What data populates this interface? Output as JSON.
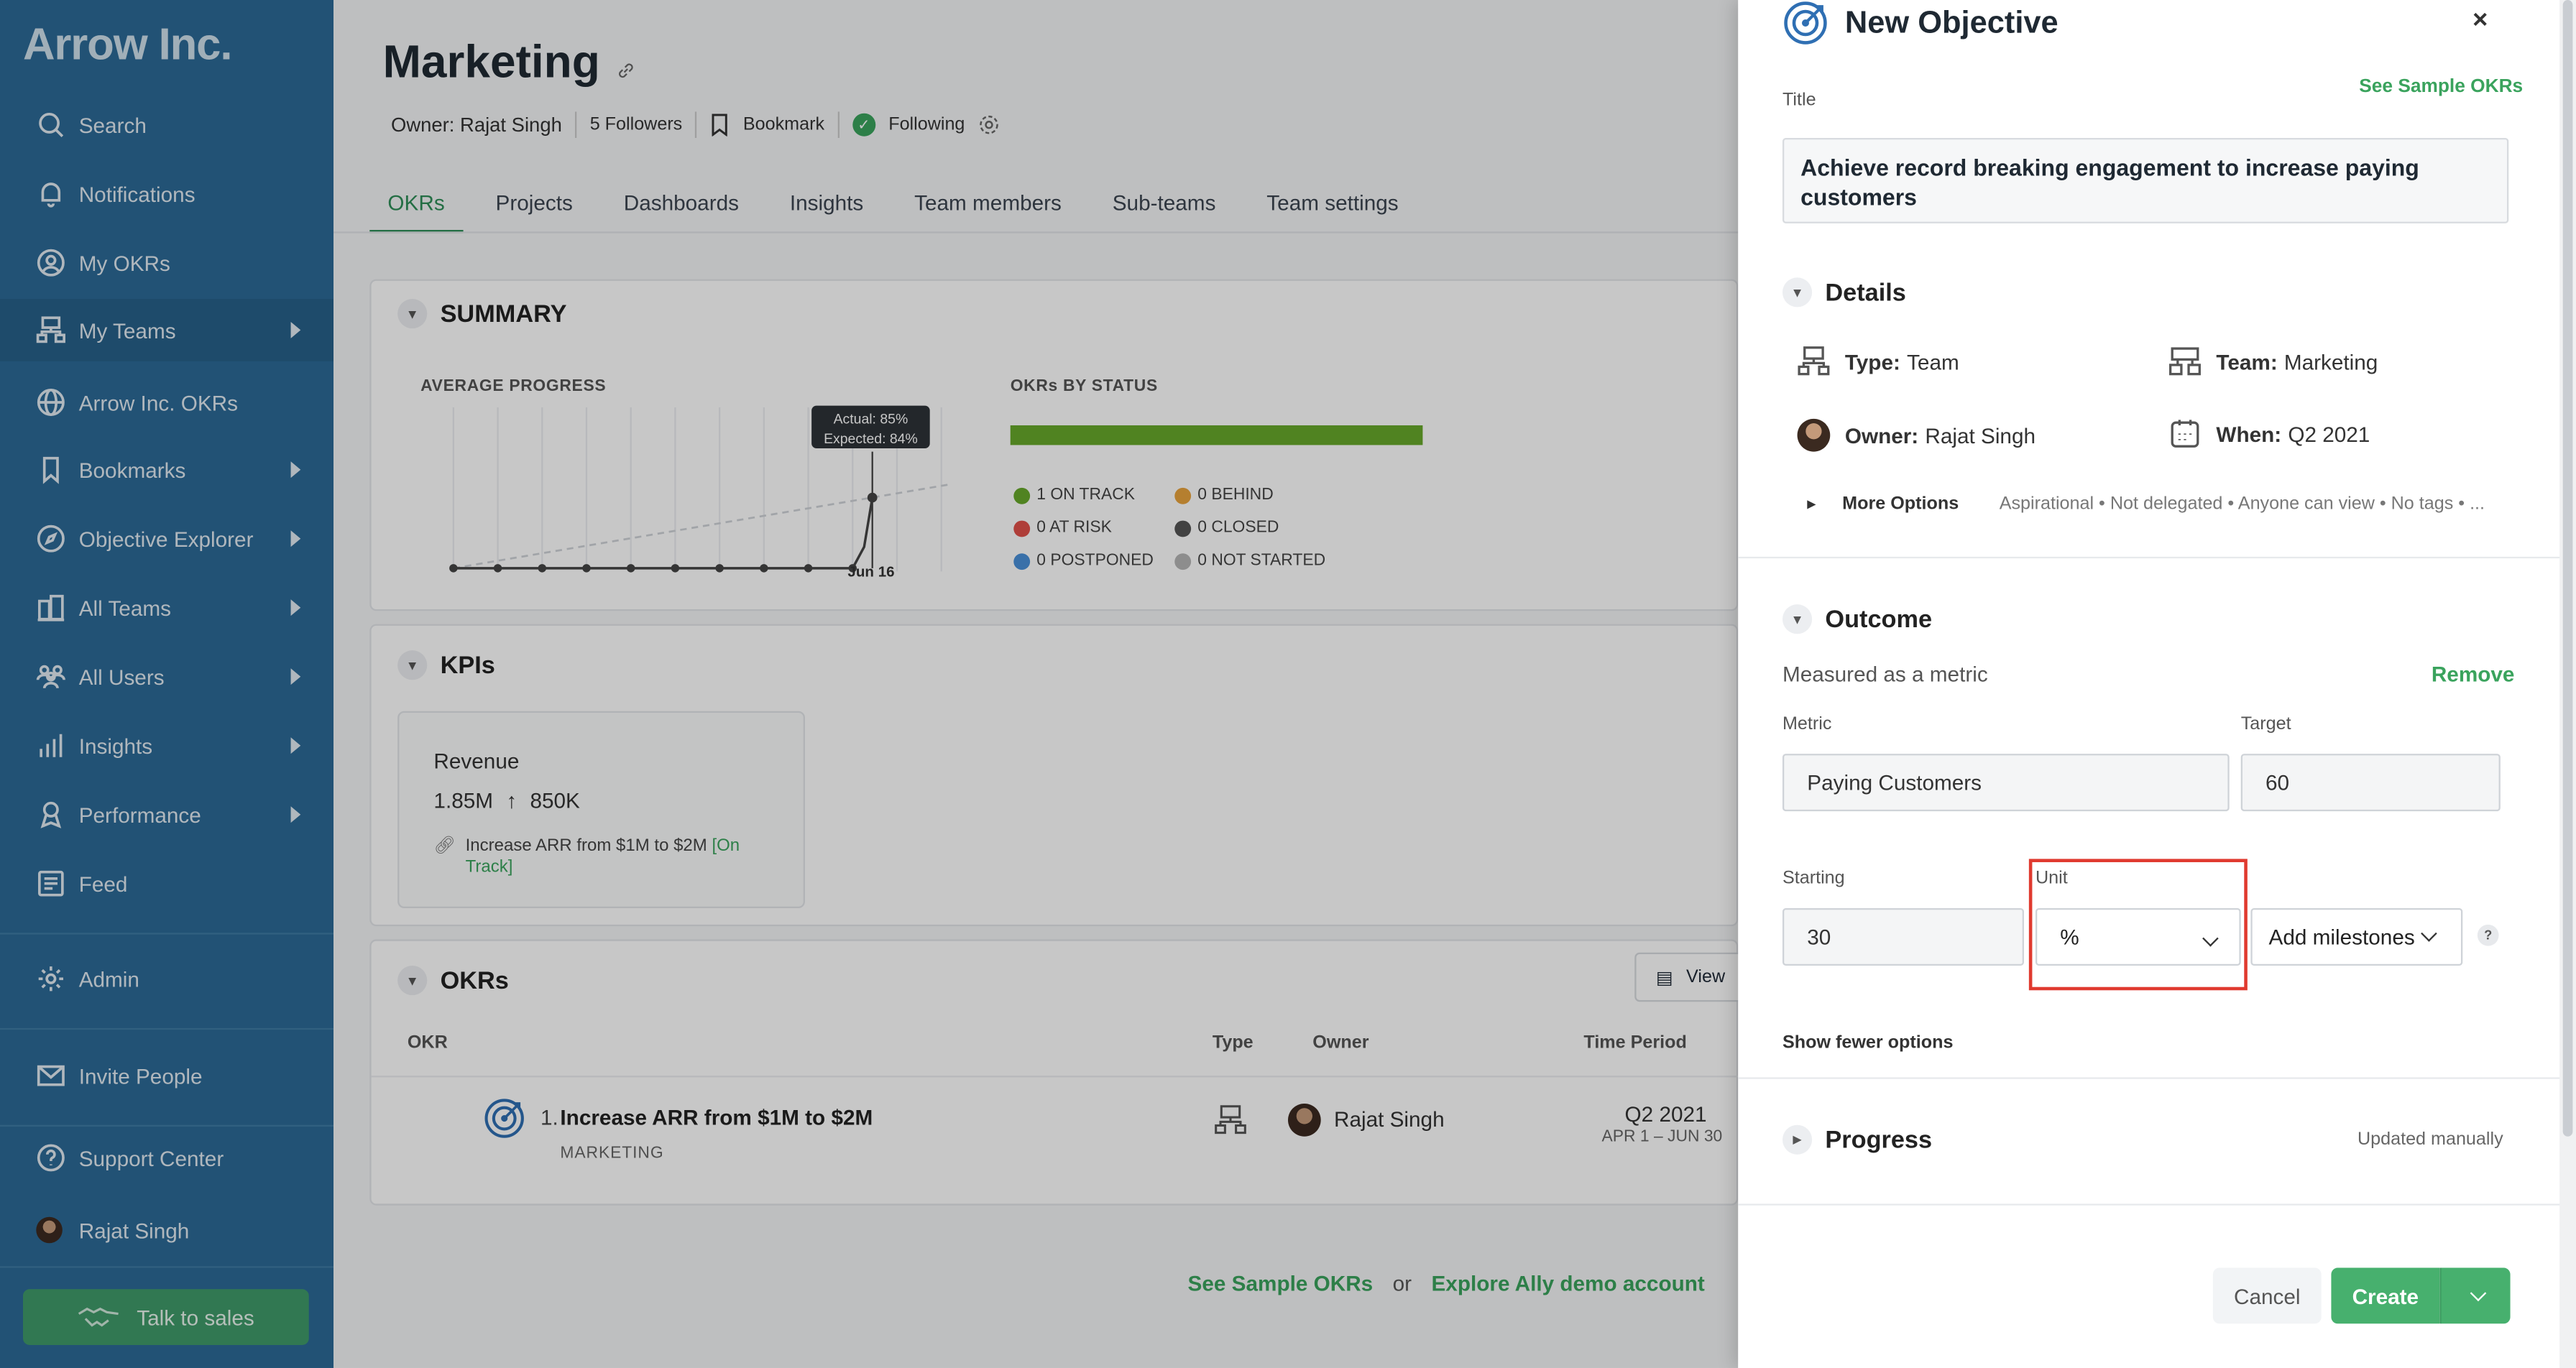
{
  "sidebar": {
    "brand": "Arrow Inc.",
    "items": [
      {
        "label": "Search",
        "icon": "search-icon"
      },
      {
        "label": "Notifications",
        "icon": "bell-icon"
      },
      {
        "label": "My OKRs",
        "icon": "user-circle-icon"
      },
      {
        "label": "My Teams",
        "icon": "team-hierarchy-icon"
      },
      {
        "label": "Arrow Inc. OKRs",
        "icon": "globe-icon"
      },
      {
        "label": "Bookmarks",
        "icon": "bookmark-icon"
      },
      {
        "label": "Objective Explorer",
        "icon": "compass-icon"
      },
      {
        "label": "All Teams",
        "icon": "buildings-icon"
      },
      {
        "label": "All Users",
        "icon": "users-icon"
      },
      {
        "label": "Insights",
        "icon": "bar-chart-icon"
      },
      {
        "label": "Performance",
        "icon": "award-icon"
      },
      {
        "label": "Feed",
        "icon": "feed-icon"
      },
      {
        "label": "Admin",
        "icon": "gear-icon"
      },
      {
        "label": "Invite People",
        "icon": "envelope-icon"
      },
      {
        "label": "Support Center",
        "icon": "help-circle-icon"
      },
      {
        "label": "Rajat Singh",
        "icon": "avatar"
      }
    ],
    "talk_to_sales": "Talk to sales"
  },
  "main": {
    "title": "Marketing",
    "owner": "Owner: Rajat Singh",
    "followers": "5 Followers",
    "bookmark": "Bookmark",
    "following": "Following",
    "tabs": [
      "OKRs",
      "Projects",
      "Dashboards",
      "Insights",
      "Team members",
      "Sub-teams",
      "Team settings"
    ],
    "summary": {
      "heading": "SUMMARY",
      "avg_progress": "AVERAGE PROGRESS",
      "tooltip_actual": "Actual: 85%",
      "tooltip_expected": "Expected: 84%",
      "date_label": "Jun 16",
      "okrs_by_status": "OKRs BY STATUS",
      "legend": [
        {
          "label": "1 ON TRACK",
          "color": "#67a82b"
        },
        {
          "label": "0 BEHIND",
          "color": "#e8a33d"
        },
        {
          "label": "0 AT RISK",
          "color": "#e0504a"
        },
        {
          "label": "0 CLOSED",
          "color": "#555555"
        },
        {
          "label": "0 POSTPONED",
          "color": "#4a90d9"
        },
        {
          "label": "0 NOT STARTED",
          "color": "#b5b5b5"
        }
      ]
    },
    "kpis": {
      "heading": "KPIs",
      "card_title": "Revenue",
      "value": "1.85M",
      "target": "850K",
      "link_text": "Increase ARR from $1M to $2M",
      "link_status": "[On Track]"
    },
    "okrs": {
      "heading": "OKRs",
      "view_button": "View",
      "columns": [
        "OKR",
        "Type",
        "Owner",
        "Time Period"
      ],
      "row": {
        "number": "1.",
        "title": "Increase ARR from $1M to $2M",
        "team": "MARKETING",
        "owner": "Rajat Singh",
        "period": "Q2 2021",
        "range": "APR 1 – JUN 30"
      },
      "see_samples": "See Sample OKRs",
      "or": "or",
      "explore_demo": "Explore Ally demo account"
    }
  },
  "drawer": {
    "title": "New Objective",
    "see_samples": "See Sample OKRs",
    "title_label": "Title",
    "title_value": "Achieve record breaking engagement to increase paying customers",
    "details": {
      "heading": "Details",
      "type_label": "Type:",
      "type_value": "Team",
      "team_label": "Team:",
      "team_value": "Marketing",
      "owner_label": "Owner:",
      "owner_value": "Rajat Singh",
      "when_label": "When:",
      "when_value": "Q2 2021",
      "more_options": "More Options",
      "more_summary": "Aspirational • Not delegated • Anyone can view • No tags • ..."
    },
    "outcome": {
      "heading": "Outcome",
      "measured": "Measured as a metric",
      "remove": "Remove",
      "metric_label": "Metric",
      "metric_value": "Paying Customers",
      "target_label": "Target",
      "target_value": "60",
      "starting_label": "Starting",
      "starting_value": "30",
      "unit_label": "Unit",
      "unit_value": "%",
      "milestones": "Add milestones",
      "help": "?",
      "show_fewer": "Show fewer options"
    },
    "progress": {
      "heading": "Progress",
      "status": "Updated manually"
    },
    "cancel": "Cancel",
    "create": "Create",
    "close": "×"
  }
}
